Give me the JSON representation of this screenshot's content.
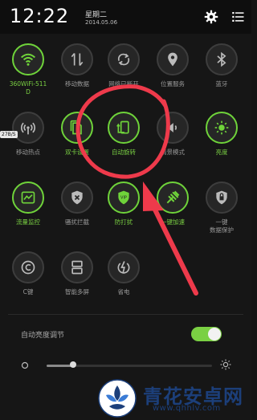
{
  "status_bar": {
    "time": "12:22",
    "weekday": "星期二",
    "date": "2014.05.06",
    "settings_icon": "gear-icon",
    "list_icon": "list-icon"
  },
  "toggles": [
    {
      "label": "360WiFi-511\nD",
      "active": true,
      "icon": "wifi-icon"
    },
    {
      "label": "移动数据",
      "active": false,
      "icon": "mobile-data-icon"
    },
    {
      "label": "网络已断开",
      "active": false,
      "icon": "network-icon"
    },
    {
      "label": "位置服务",
      "active": false,
      "icon": "location-icon"
    },
    {
      "label": "蓝牙",
      "active": false,
      "icon": "bluetooth-icon"
    },
    {
      "label": "移动热点",
      "active": false,
      "icon": "hotspot-icon"
    },
    {
      "label": "双卡设置",
      "active": true,
      "icon": "dual-sim-icon"
    },
    {
      "label": "自动旋转",
      "active": true,
      "icon": "auto-rotate-icon"
    },
    {
      "label": "情景模式",
      "active": false,
      "icon": "sound-mode-icon"
    },
    {
      "label": "亮度",
      "active": true,
      "icon": "brightness-icon"
    },
    {
      "label": "流量监控",
      "active": true,
      "icon": "traffic-monitor-icon"
    },
    {
      "label": "骚扰拦截",
      "active": false,
      "icon": "shield-icon"
    },
    {
      "label": "防打扰",
      "active": true,
      "icon": "do-not-disturb-icon"
    },
    {
      "label": "一键加速",
      "active": true,
      "icon": "speed-up-icon"
    },
    {
      "label": "一键\n数据保护",
      "active": false,
      "icon": "data-protect-icon"
    },
    {
      "label": "C键",
      "active": false,
      "icon": "c-key-icon"
    },
    {
      "label": "智能多屏",
      "active": false,
      "icon": "multi-screen-icon"
    },
    {
      "label": "省电",
      "active": false,
      "icon": "power-saving-icon"
    }
  ],
  "network_speed": "27B/S",
  "auto_brightness": {
    "label": "自动亮度调节",
    "enabled": true
  },
  "brightness_level": 0.16,
  "colors": {
    "accent": "#7ad043",
    "annotation": "#ee3a4b",
    "watermark": "#1c3f7a"
  },
  "watermark": {
    "name": "青花安卓网",
    "url": "www.qhhlv.com"
  }
}
